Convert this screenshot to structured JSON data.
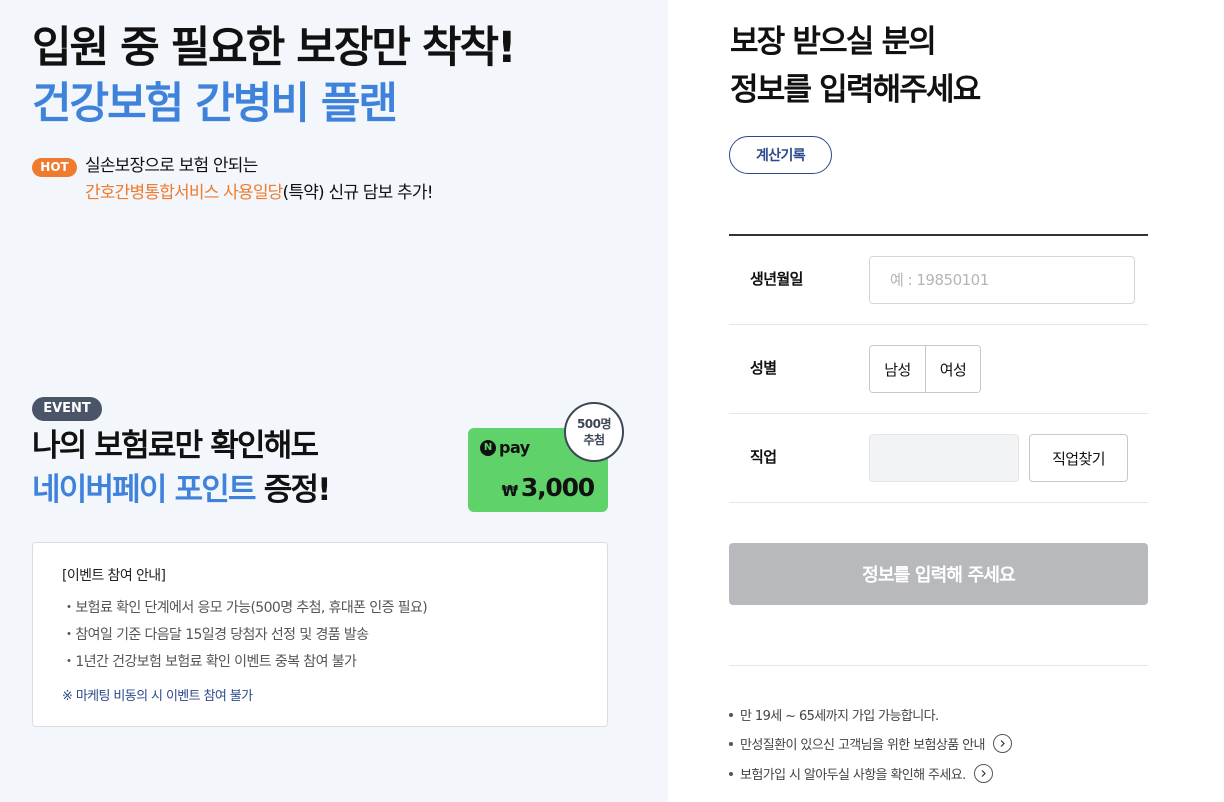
{
  "hero": {
    "title": "입원 중 필요한 보장만 착착!",
    "subtitle": "건강보험 간병비 플랜",
    "hot_badge": "HOT",
    "hot_line1": "실손보장으로 보험 안되는",
    "hot_line2_highlight": "간호간병통합서비스 사용일당",
    "hot_line2_rest": "(특약) 신규 담보 추가!"
  },
  "event": {
    "badge": "EVENT",
    "line1": "나의 보험료만 확인해도",
    "line2_highlight": "네이버페이 포인트",
    "line2_rest": " 증정!",
    "npay_n": "N",
    "npay_label": "pay",
    "npay_currency": "₩",
    "npay_amount": "3,000",
    "stamp_line1": "500명",
    "stamp_line2": "추첨",
    "guide_title": "[이벤트 참여 안내]",
    "guide_items": [
      "・보험료 확인 단계에서 응모 가능(500명 추첨, 휴대폰 인증 필요)",
      "・참여일 기준 다음달 15일경 당첨자 선정 및 경품 발송",
      "・1년간 건강보험 보험료 확인 이벤트 중복 참여 불가"
    ],
    "guide_note": "※ 마케팅 비동의 시 이벤트 참여 불가"
  },
  "form": {
    "title_line1": "보장 받으실 분의",
    "title_line2": "정보를 입력해주세요",
    "history_button": "계산기록",
    "birth_label": "생년월일",
    "birth_placeholder": "예 : 19850101",
    "birth_value": "",
    "gender_label": "성별",
    "gender_male": "남성",
    "gender_female": "여성",
    "job_label": "직업",
    "job_value": "",
    "job_search_button": "직업찾기",
    "submit_button": "정보를 입력해 주세요"
  },
  "notices": [
    "만 19세 ~ 65세까지 가입 가능합니다.",
    "만성질환이 있으신 고객님을 위한 보험상품 안내",
    "보험가입 시 알아두실 사항을 확인해 주세요."
  ],
  "colors": {
    "accent_blue": "#3f82db",
    "hot_orange": "#ef7b2f",
    "navy": "#2c4a8c",
    "npay_green": "#5fd26a",
    "disabled_gray": "#b7b9bd"
  }
}
